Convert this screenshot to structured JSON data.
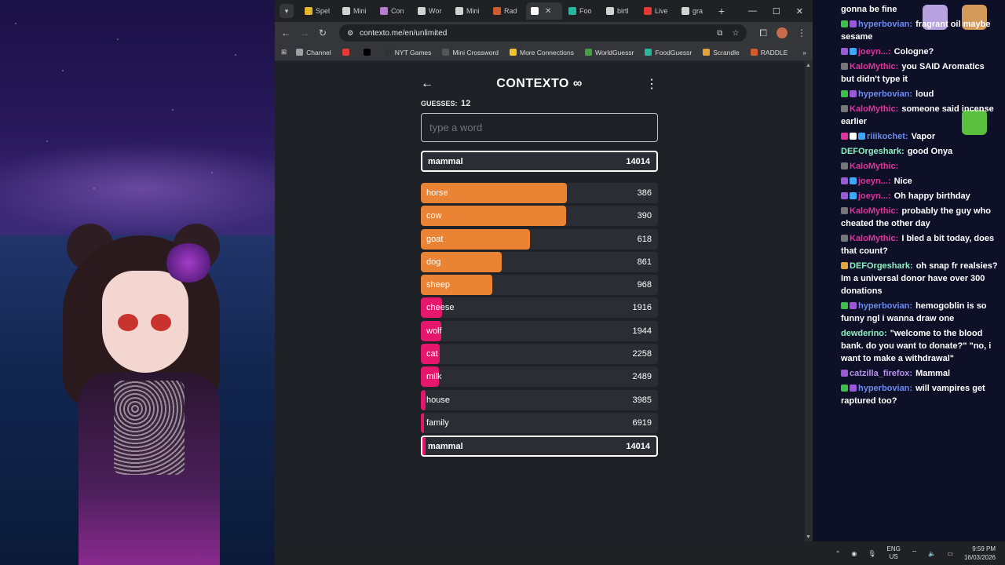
{
  "browser": {
    "tabs": [
      {
        "label": "Spel",
        "color": "#e8b62a",
        "active": false
      },
      {
        "label": "Mini",
        "color": "#d2d2d2",
        "active": false
      },
      {
        "label": "Con",
        "color": "#b77ccf",
        "active": false
      },
      {
        "label": "Wor",
        "color": "#d2d2d2",
        "active": false
      },
      {
        "label": "Mini",
        "color": "#d2d2d2",
        "active": false
      },
      {
        "label": "Rad",
        "color": "#d05b2c",
        "active": false
      },
      {
        "label": "",
        "color": "#ffffff",
        "active": true
      },
      {
        "label": "Foo",
        "color": "#2ab7a0",
        "active": false
      },
      {
        "label": "birtl",
        "color": "#d2d2d2",
        "active": false
      },
      {
        "label": "Live",
        "color": "#e53935",
        "active": false
      },
      {
        "label": "gra",
        "color": "#d2d2d2",
        "active": false
      }
    ],
    "url": "contexto.me/en/unlimited",
    "bookmarks": [
      {
        "label": "Channel",
        "color": "#9aa0a6"
      },
      {
        "label": "",
        "color": "#e53935"
      },
      {
        "label": "",
        "color": "#000000"
      },
      {
        "label": "NYT Games",
        "color": "#333333"
      },
      {
        "label": "Mini Crossword",
        "color": "#555555"
      },
      {
        "label": "More Connections",
        "color": "#f2c12e"
      },
      {
        "label": "WorldGuessr",
        "color": "#43a047"
      },
      {
        "label": "FoodGuessr",
        "color": "#2ab7a0"
      },
      {
        "label": "Scrandle",
        "color": "#e5a33b"
      },
      {
        "label": "RADDLE",
        "color": "#d05b2c"
      }
    ]
  },
  "game": {
    "title": "CONTEXTO ∞",
    "guesses_label": "GUESSES:",
    "guesses_count": "12",
    "input_placeholder": "type a word",
    "current": {
      "word": "mammal",
      "distance": "14014"
    },
    "list": [
      {
        "word": "horse",
        "distance": "386",
        "fill": 0.615,
        "color": "#ea8434"
      },
      {
        "word": "cow",
        "distance": "390",
        "fill": 0.612,
        "color": "#ea8434"
      },
      {
        "word": "goat",
        "distance": "618",
        "fill": 0.46,
        "color": "#ea8434"
      },
      {
        "word": "dog",
        "distance": "861",
        "fill": 0.34,
        "color": "#ea8434"
      },
      {
        "word": "sheep",
        "distance": "968",
        "fill": 0.3,
        "color": "#ea8434"
      },
      {
        "word": "cheese",
        "distance": "1916",
        "fill": 0.09,
        "color": "#e6166c"
      },
      {
        "word": "wolf",
        "distance": "1944",
        "fill": 0.085,
        "color": "#e6166c"
      },
      {
        "word": "cat",
        "distance": "2258",
        "fill": 0.08,
        "color": "#e6166c"
      },
      {
        "word": "milk",
        "distance": "2489",
        "fill": 0.075,
        "color": "#e6166c"
      },
      {
        "word": "house",
        "distance": "3985",
        "fill": 0.02,
        "color": "#e6166c"
      },
      {
        "word": "family",
        "distance": "6919",
        "fill": 0.01,
        "color": "#e6166c"
      },
      {
        "word": "mammal",
        "distance": "14014",
        "fill": 0.0,
        "color": "#e6166c",
        "highlight": true
      }
    ]
  },
  "chat": {
    "messages": [
      {
        "user": "",
        "text": "gonna be fine",
        "ucolor": "#ffffff",
        "badges": []
      },
      {
        "user": "hyperbovian:",
        "text": "fragrant oil maybe sesame",
        "ucolor": "#6a8cf0",
        "badges": [
          "#3cbf4a",
          "#9b59d6"
        ]
      },
      {
        "user": "joeyn...:",
        "text": "Cologne?",
        "ucolor": "#e0339d",
        "badges": [
          "#9b59d6",
          "#3ea6ff"
        ]
      },
      {
        "user": "KaloMythic:",
        "text": "you SAID Aromatics but didn't type it",
        "ucolor": "#e0339d",
        "badges": [
          "#777777"
        ]
      },
      {
        "user": "hyperbovian:",
        "text": "loud",
        "ucolor": "#6a8cf0",
        "badges": [
          "#3cbf4a",
          "#9b59d6"
        ]
      },
      {
        "user": "KaloMythic:",
        "text": "someone said incense earlier",
        "ucolor": "#e0339d",
        "badges": [
          "#777777"
        ]
      },
      {
        "user": "riiikochet:",
        "text": "Vapor",
        "ucolor": "#6a8cf0",
        "badges": [
          "#e0339d",
          "#ffffff",
          "#3ea6ff"
        ]
      },
      {
        "user": "DEFOrgeshark:",
        "text": "good Onya",
        "ucolor": "#8ef0c0",
        "badges": []
      },
      {
        "user": "KaloMythic:",
        "text": "",
        "ucolor": "#e0339d",
        "badges": [
          "#777777"
        ]
      },
      {
        "user": "joeyn...:",
        "text": "Nice",
        "ucolor": "#e0339d",
        "badges": [
          "#9b59d6",
          "#3ea6ff"
        ]
      },
      {
        "user": "joeyn...:",
        "text": "Oh happy birthday",
        "ucolor": "#e0339d",
        "badges": [
          "#9b59d6",
          "#3ea6ff"
        ]
      },
      {
        "user": "KaloMythic:",
        "text": "probably the guy who cheated the other day",
        "ucolor": "#e0339d",
        "badges": [
          "#777777"
        ]
      },
      {
        "user": "KaloMythic:",
        "text": "I bled a bit today, does that count?",
        "ucolor": "#e0339d",
        "badges": [
          "#777777"
        ]
      },
      {
        "user": "DEFOrgeshark:",
        "text": "oh snap fr realsies? Im a universal donor have over 300 donations",
        "ucolor": "#8ef0c0",
        "badges": [
          "#e5a33b"
        ]
      },
      {
        "user": "hyperbovian:",
        "text": "hemogoblin is so funny ngl i wanna draw one",
        "ucolor": "#6a8cf0",
        "badges": [
          "#3cbf4a",
          "#9b59d6"
        ]
      },
      {
        "user": "dewderino:",
        "text": "\"welcome to the blood bank. do you want to donate?\" \"no, i want to make a withdrawal\"",
        "ucolor": "#8ef0c0",
        "badges": []
      },
      {
        "user": "catzilla_firefox:",
        "text": "Mammal",
        "ucolor": "#b78ff0",
        "badges": [
          "#9b59d6"
        ]
      },
      {
        "user": "hyperbovian:",
        "text": "will vampires get raptured too?",
        "ucolor": "#6a8cf0",
        "badges": [
          "#3cbf4a",
          "#9b59d6"
        ]
      }
    ]
  },
  "taskbar": {
    "lang_top": "ENG",
    "lang_bottom": "US",
    "time": "9:59 PM",
    "date": "16/03/2026"
  }
}
